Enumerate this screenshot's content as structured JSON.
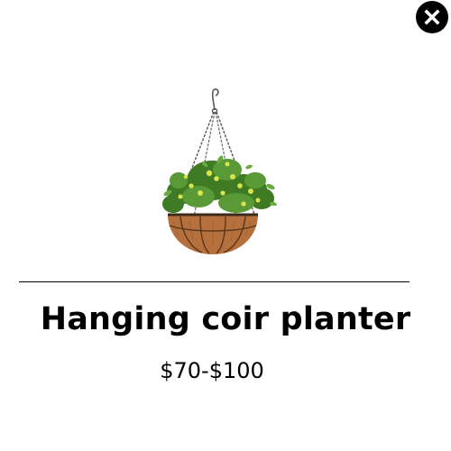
{
  "modal": {
    "close_icon": "close-icon",
    "product": {
      "image_icon": "hanging-planter-image",
      "title": "Hanging coir planter",
      "price": "$70-$100"
    }
  },
  "colors": {
    "background": "#ffffff",
    "text": "#000000",
    "close_button_bg": "#000000",
    "close_button_fg": "#ffffff",
    "coir": "#b5703d",
    "coir_dark": "#7a4520",
    "foliage": "#4f8a2e",
    "flowers": "#d8e24a",
    "chain": "#555555"
  }
}
